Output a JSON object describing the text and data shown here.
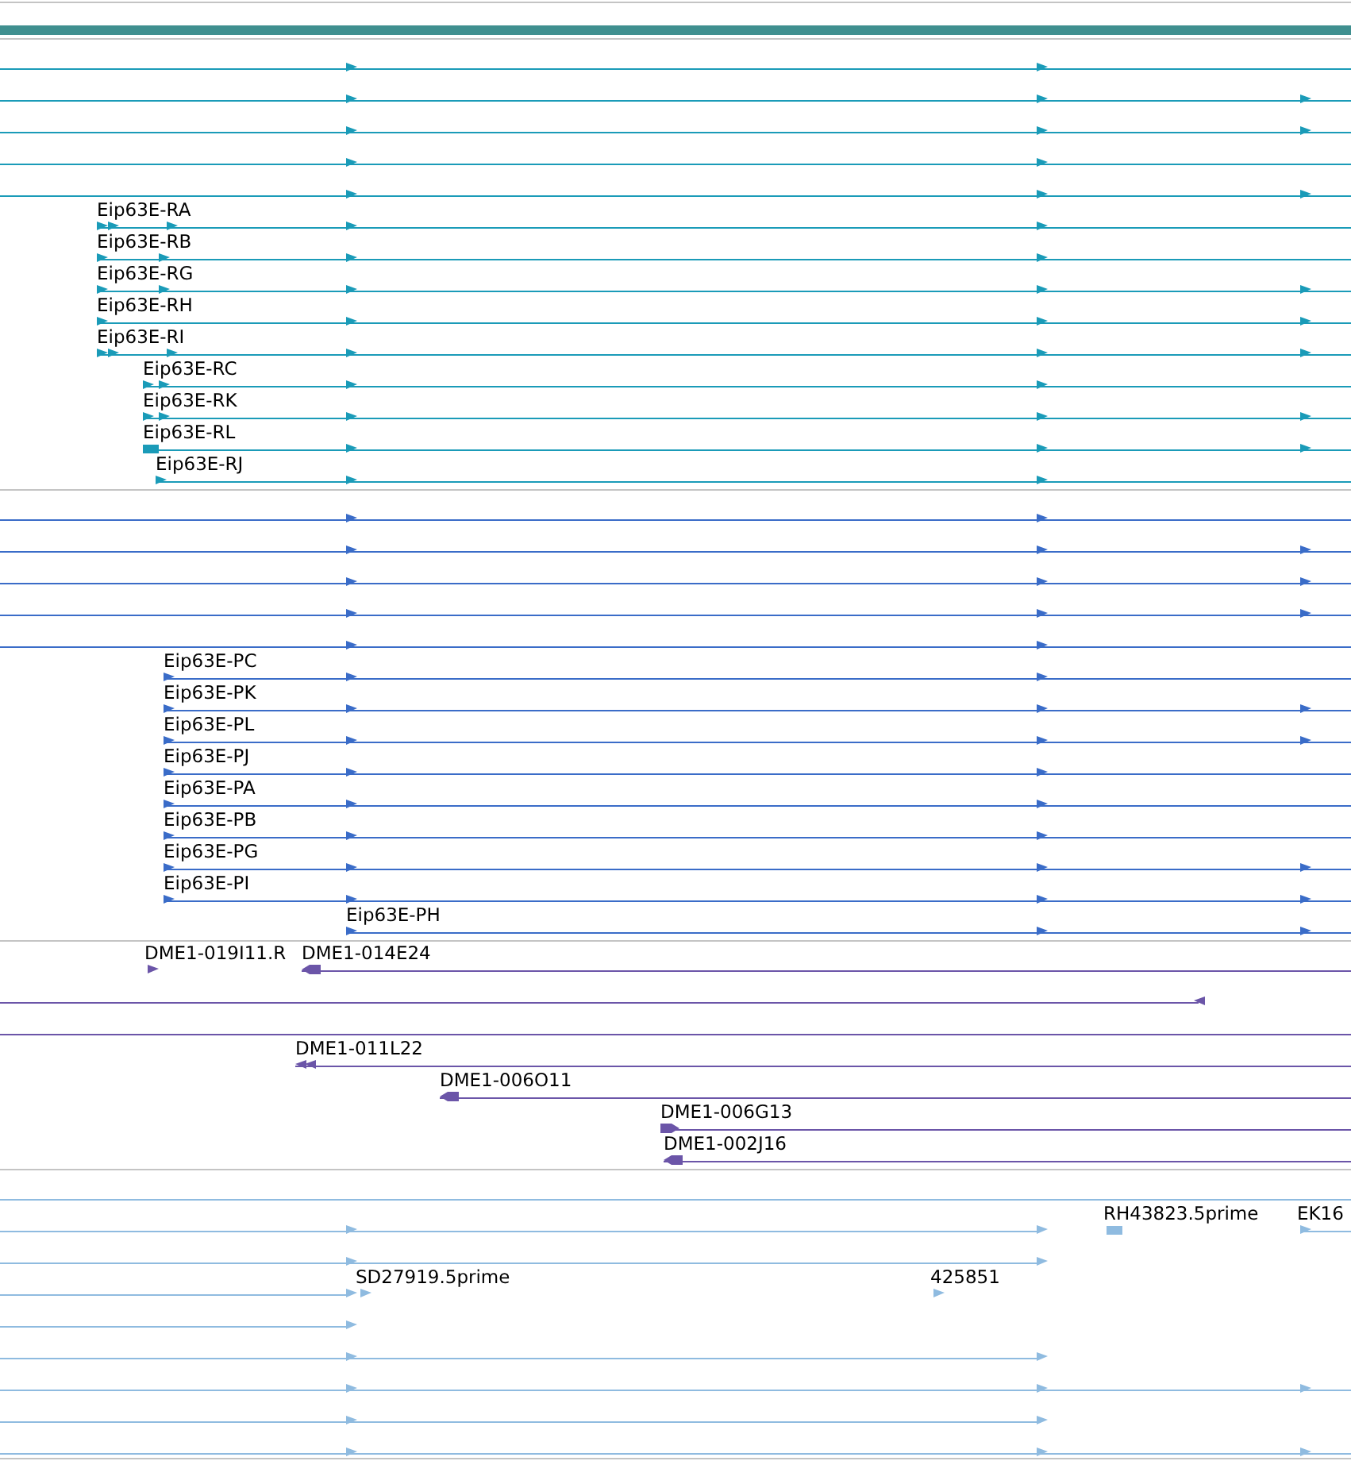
{
  "tracks": [
    {
      "color": "#1a9bb8",
      "labels": [
        "Eip63E-RA",
        "Eip63E-RB",
        "Eip63E-RG",
        "Eip63E-RH",
        "Eip63E-RI",
        "Eip63E-RC",
        "Eip63E-RK",
        "Eip63E-RL",
        "Eip63E-RJ"
      ]
    },
    {
      "color": "#3a6cc8",
      "labels": [
        "Eip63E-PC",
        "Eip63E-PK",
        "Eip63E-PL",
        "Eip63E-PJ",
        "Eip63E-PA",
        "Eip63E-PB",
        "Eip63E-PG",
        "Eip63E-PI",
        "Eip63E-PH"
      ]
    },
    {
      "color": "#6b55a8",
      "labels": [
        "DME1-019I11.R",
        "DME1-014E24",
        "DME1-011L22",
        "DME1-006O11",
        "DME1-006G13",
        "DME1-002J16"
      ]
    },
    {
      "color": "#8fbbe0",
      "labels": [
        "RH43823.5prime",
        "EK16",
        "SD27919.5prime",
        "425851"
      ]
    }
  ]
}
